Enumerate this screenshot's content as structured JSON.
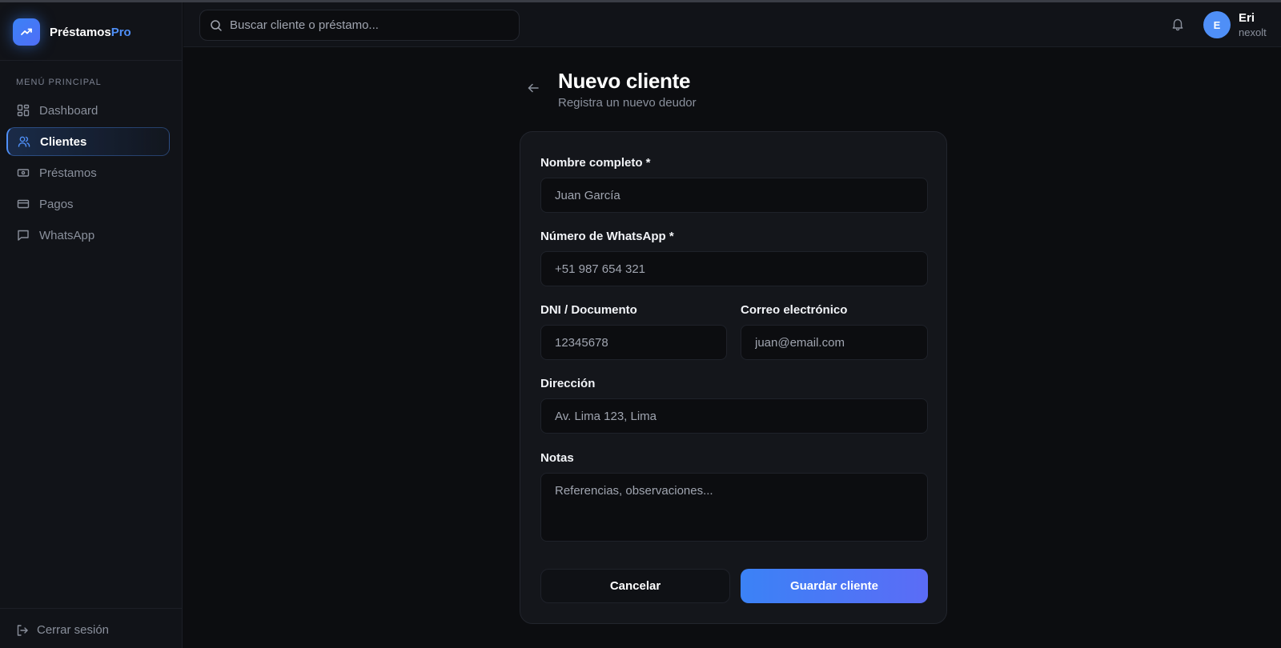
{
  "brand": {
    "name_main": "Préstamos",
    "name_accent": "Pro",
    "accent_color": "#4f8ff7"
  },
  "sidebar": {
    "heading": "MENÚ PRINCIPAL",
    "items": [
      {
        "label": "Dashboard",
        "icon": "dashboard-icon",
        "active": false
      },
      {
        "label": "Clientes",
        "icon": "users-icon",
        "active": true
      },
      {
        "label": "Préstamos",
        "icon": "banknote-icon",
        "active": false
      },
      {
        "label": "Pagos",
        "icon": "credit-card-icon",
        "active": false
      },
      {
        "label": "WhatsApp",
        "icon": "message-icon",
        "active": false
      }
    ],
    "logout_label": "Cerrar sesión"
  },
  "topbar": {
    "search_placeholder": "Buscar cliente o préstamo...",
    "user": {
      "initial": "E",
      "name": "Eri",
      "subtitle": "nexolt"
    }
  },
  "page": {
    "title": "Nuevo cliente",
    "subtitle": "Registra un nuevo deudor"
  },
  "form": {
    "full_name": {
      "label": "Nombre completo *",
      "placeholder": "Juan García",
      "value": ""
    },
    "whatsapp": {
      "label": "Número de WhatsApp *",
      "placeholder": "+51 987 654 321",
      "value": ""
    },
    "document": {
      "label": "DNI / Documento",
      "placeholder": "12345678",
      "value": ""
    },
    "email": {
      "label": "Correo electrónico",
      "placeholder": "juan@email.com",
      "value": ""
    },
    "address": {
      "label": "Dirección",
      "placeholder": "Av. Lima 123, Lima",
      "value": ""
    },
    "notes": {
      "label": "Notas",
      "placeholder": "Referencias, observaciones...",
      "value": ""
    },
    "cancel_label": "Cancelar",
    "save_label": "Guardar cliente"
  }
}
